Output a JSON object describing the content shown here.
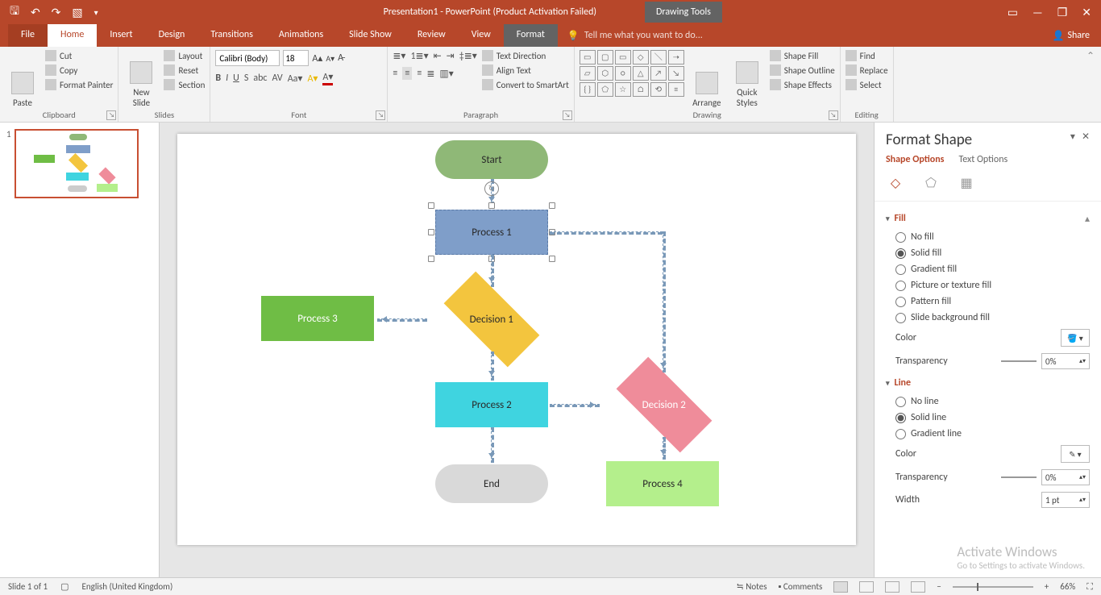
{
  "titlebar": {
    "doc_title": "Presentation1 - PowerPoint (Product Activation Failed)",
    "context_tab": "Drawing Tools"
  },
  "tabs": {
    "file": "File",
    "home": "Home",
    "insert": "Insert",
    "design": "Design",
    "transitions": "Transitions",
    "animations": "Animations",
    "slideshow": "Slide Show",
    "review": "Review",
    "view": "View",
    "format": "Format",
    "tellme": "Tell me what you want to do...",
    "share": "Share"
  },
  "ribbon": {
    "clipboard": {
      "paste": "Paste",
      "cut": "Cut",
      "copy": "Copy",
      "painter": "Format Painter",
      "label": "Clipboard"
    },
    "slides": {
      "new": "New\nSlide",
      "layout": "Layout",
      "reset": "Reset",
      "section": "Section",
      "label": "Slides"
    },
    "font": {
      "name": "Calibri (Body)",
      "size": "18",
      "label": "Font"
    },
    "paragraph": {
      "textdir": "Text Direction",
      "align": "Align Text",
      "smartart": "Convert to SmartArt",
      "label": "Paragraph"
    },
    "drawing": {
      "arrange": "Arrange",
      "quick": "Quick\nStyles",
      "fill": "Shape Fill",
      "outline": "Shape Outline",
      "effects": "Shape Effects",
      "label": "Drawing"
    },
    "editing": {
      "find": "Find",
      "replace": "Replace",
      "select": "Select",
      "label": "Editing"
    }
  },
  "thumbs": {
    "num": "1"
  },
  "flowchart": {
    "start": "Start",
    "p1": "Process 1",
    "p2": "Process 2",
    "p3": "Process 3",
    "p4": "Process 4",
    "d1": "Decision 1",
    "d2": "Decision 2",
    "end": "End"
  },
  "pane": {
    "title": "Format Shape",
    "tab_shape": "Shape Options",
    "tab_text": "Text Options",
    "fill": {
      "label": "Fill",
      "none": "No fill",
      "solid": "Solid fill",
      "gradient": "Gradient fill",
      "picture": "Picture or texture fill",
      "pattern": "Pattern fill",
      "slidebg": "Slide background fill",
      "color": "Color",
      "transparency": "Transparency",
      "trans_val": "0%"
    },
    "line": {
      "label": "Line",
      "none": "No line",
      "solid": "Solid line",
      "gradient": "Gradient line",
      "color": "Color",
      "transparency": "Transparency",
      "trans_val": "0%",
      "width": "Width",
      "width_val": "1 pt"
    }
  },
  "status": {
    "slide": "Slide 1 of 1",
    "lang": "English (United Kingdom)",
    "notes": "Notes",
    "comments": "Comments",
    "zoom": "66%"
  },
  "watermark": {
    "title": "Activate Windows",
    "sub": "Go to Settings to activate Windows."
  }
}
